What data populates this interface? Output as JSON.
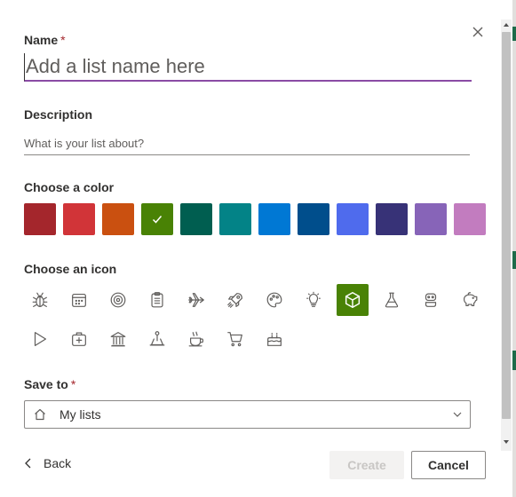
{
  "form": {
    "name_label": "Name",
    "required_mark": "*",
    "name_placeholder": "Add a list name here",
    "description_label": "Description",
    "description_placeholder": "What is your list about?",
    "color_label": "Choose a color",
    "icon_label": "Choose an icon",
    "save_to_label": "Save to",
    "save_to_value": "My lists"
  },
  "colors": [
    {
      "name": "dark-red",
      "hex": "#a4262c",
      "selected": false
    },
    {
      "name": "red",
      "hex": "#d13438",
      "selected": false
    },
    {
      "name": "orange",
      "hex": "#ca5010",
      "selected": false
    },
    {
      "name": "green",
      "hex": "#498205",
      "selected": true
    },
    {
      "name": "dark-teal",
      "hex": "#005e50",
      "selected": false
    },
    {
      "name": "teal",
      "hex": "#038387",
      "selected": false
    },
    {
      "name": "blue",
      "hex": "#0078d4",
      "selected": false
    },
    {
      "name": "dark-blue",
      "hex": "#004e8c",
      "selected": false
    },
    {
      "name": "periwinkle",
      "hex": "#4f6bed",
      "selected": false
    },
    {
      "name": "indigo",
      "hex": "#373277",
      "selected": false
    },
    {
      "name": "purple",
      "hex": "#8764b8",
      "selected": false
    },
    {
      "name": "pink",
      "hex": "#c27cbf",
      "selected": false
    }
  ],
  "icons": [
    {
      "name": "bug-icon",
      "selected": false
    },
    {
      "name": "calendar-icon",
      "selected": false
    },
    {
      "name": "target-icon",
      "selected": false
    },
    {
      "name": "clipboard-icon",
      "selected": false
    },
    {
      "name": "airplane-icon",
      "selected": false
    },
    {
      "name": "rocket-icon",
      "selected": false
    },
    {
      "name": "palette-icon",
      "selected": false
    },
    {
      "name": "lightbulb-icon",
      "selected": false
    },
    {
      "name": "cube-icon",
      "selected": true
    },
    {
      "name": "beaker-icon",
      "selected": false
    },
    {
      "name": "robot-icon",
      "selected": false
    },
    {
      "name": "piggy-bank-icon",
      "selected": false
    },
    {
      "name": "play-icon",
      "selected": false
    },
    {
      "name": "first-aid-kit-icon",
      "selected": false
    },
    {
      "name": "bank-icon",
      "selected": false
    },
    {
      "name": "joystick-icon",
      "selected": false
    },
    {
      "name": "coffee-icon",
      "selected": false
    },
    {
      "name": "shopping-cart-icon",
      "selected": false
    },
    {
      "name": "cake-icon",
      "selected": false
    }
  ],
  "footer": {
    "back_label": "Back",
    "create_label": "Create",
    "cancel_label": "Cancel"
  },
  "accent": {
    "focus_underline": "#8a4ba4",
    "selected_icon_bg": "#498205"
  }
}
